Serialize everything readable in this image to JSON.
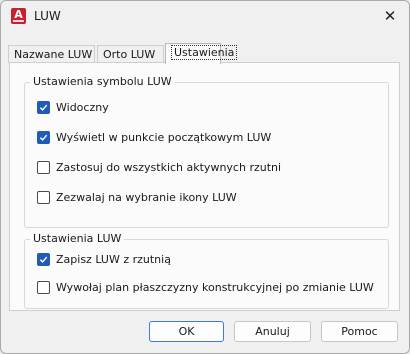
{
  "window": {
    "title": "LUW",
    "icon": "autocad-app-icon",
    "close_glyph": "✕"
  },
  "tabs": [
    {
      "label": "Nazwane LUW",
      "active": false
    },
    {
      "label": "Orto LUW",
      "active": false
    },
    {
      "label": "Ustawienia",
      "active": true
    }
  ],
  "symbol_group": {
    "title": "Ustawienia symbolu LUW",
    "items": [
      {
        "label": "Widoczny",
        "checked": true
      },
      {
        "label": "Wyświetl w punkcie początkowym LUW",
        "checked": true
      },
      {
        "label": "Zastosuj do wszystkich aktywnych rzutni",
        "checked": false
      },
      {
        "label": "Zezwalaj na wybranie ikony LUW",
        "checked": false
      }
    ]
  },
  "luw_group": {
    "title": "Ustawienia LUW",
    "items": [
      {
        "label": "Zapisz LUW z rzutnią",
        "checked": true
      },
      {
        "label": "Wywołaj plan płaszczyzny konstrukcyjnej po zmianie LUW",
        "checked": false
      }
    ]
  },
  "buttons": {
    "ok": "OK",
    "cancel": "Anuluj",
    "help": "Pomoc"
  },
  "colors": {
    "accent": "#1f5bb7",
    "default_button_border": "#3f7bd4",
    "app_icon": "#c8202f"
  }
}
